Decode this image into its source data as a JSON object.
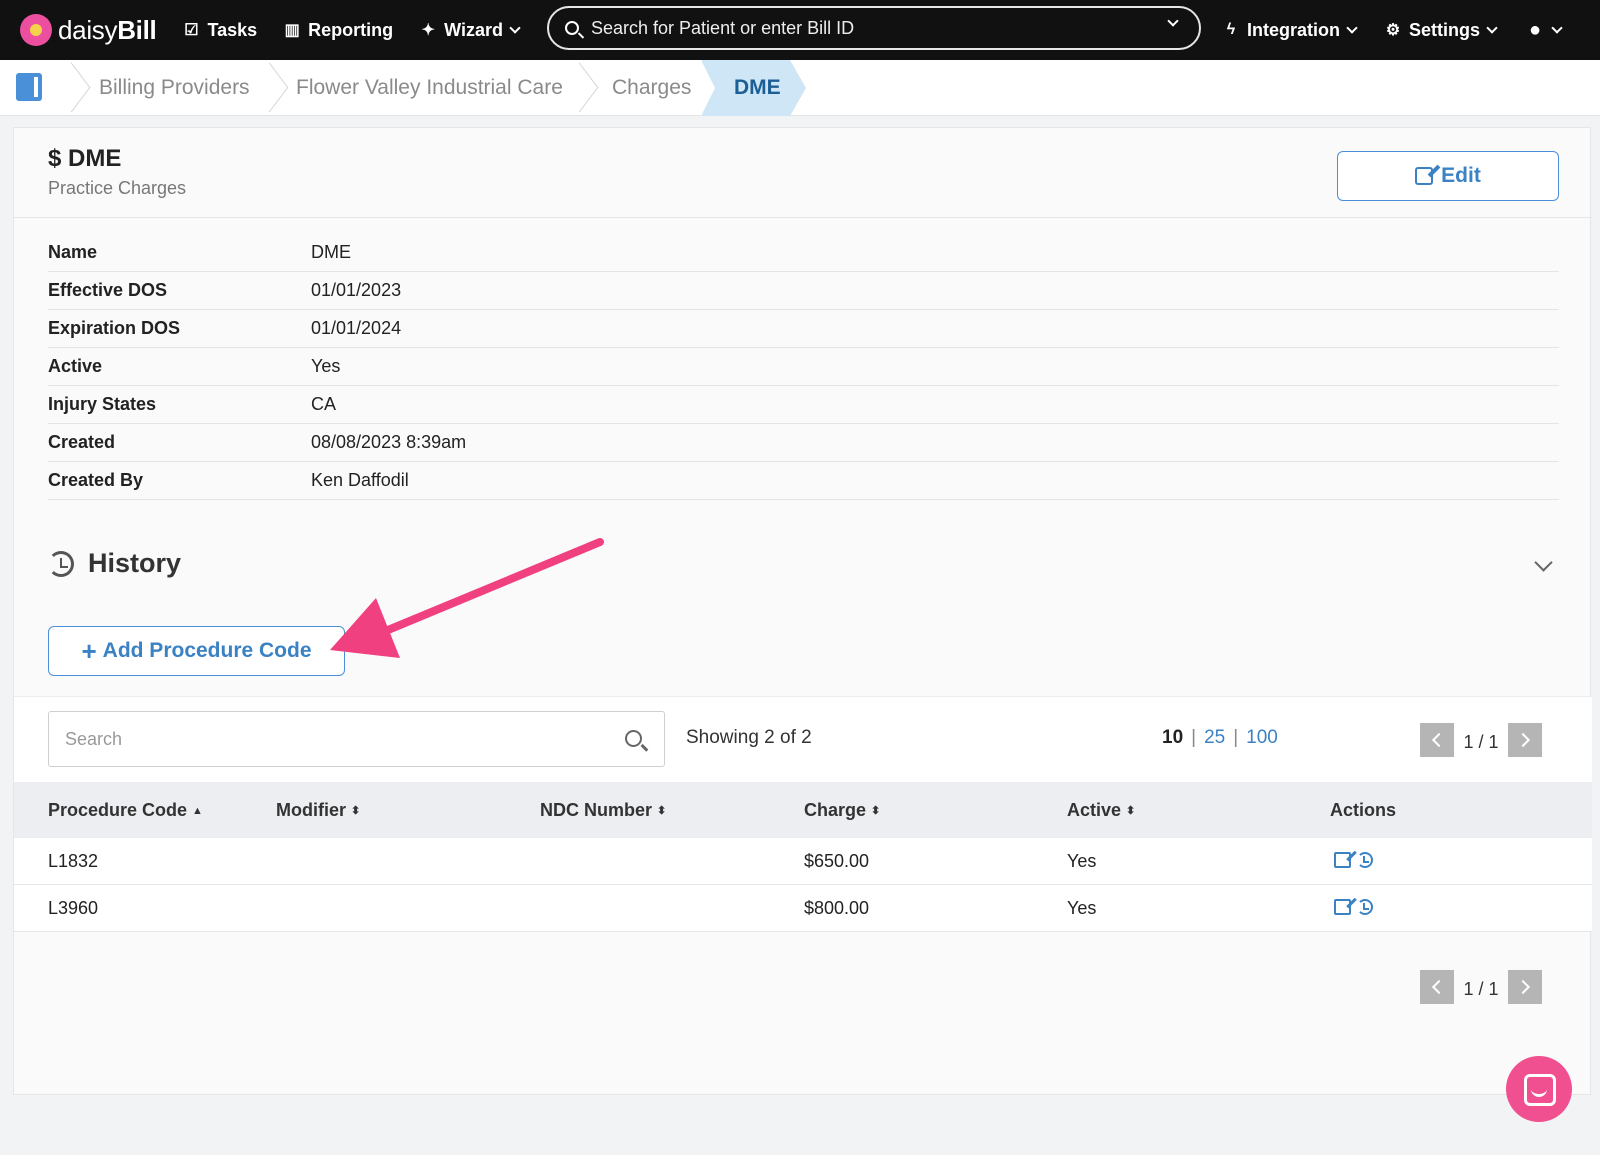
{
  "nav": {
    "brand_prefix": "daisy",
    "brand_suffix": "Bill",
    "tasks": "Tasks",
    "reporting": "Reporting",
    "wizard": "Wizard",
    "search_placeholder": "Search for Patient or enter Bill ID",
    "integration": "Integration",
    "settings": "Settings"
  },
  "breadcrumb": [
    "Billing Providers",
    "Flower Valley Industrial Care",
    "Charges",
    "DME"
  ],
  "card": {
    "title": "$ DME",
    "subtitle": "Practice Charges",
    "edit_label": "Edit"
  },
  "details": [
    {
      "label": "Name",
      "value": "DME"
    },
    {
      "label": "Effective DOS",
      "value": "01/01/2023"
    },
    {
      "label": "Expiration DOS",
      "value": "01/01/2024"
    },
    {
      "label": "Active",
      "value": "Yes"
    },
    {
      "label": "Injury States",
      "value": "CA"
    },
    {
      "label": "Created",
      "value": "08/08/2023 8:39am"
    },
    {
      "label": "Created By",
      "value": "Ken Daffodil"
    }
  ],
  "history_label": "History",
  "add_button": "Add Procedure Code",
  "table_toolbar": {
    "search_placeholder": "Search",
    "showing": "Showing 2 of 2",
    "page_sizes": [
      "10",
      "25",
      "100"
    ],
    "page_indicator": "1 / 1"
  },
  "table": {
    "headers": [
      "Procedure Code",
      "Modifier",
      "NDC Number",
      "Charge",
      "Active",
      "Actions"
    ],
    "rows": [
      {
        "procedure_code": "L1832",
        "modifier": "",
        "ndc": "",
        "charge": "$650.00",
        "active": "Yes"
      },
      {
        "procedure_code": "L3960",
        "modifier": "",
        "ndc": "",
        "charge": "$800.00",
        "active": "Yes"
      }
    ]
  },
  "colors": {
    "accent": "#3b82c4",
    "annotation_arrow": "#f0407f",
    "chat_button": "#f0508f"
  }
}
